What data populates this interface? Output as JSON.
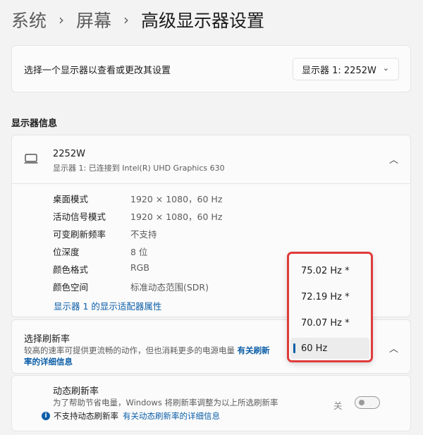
{
  "breadcrumb": [
    "系统",
    "屏幕",
    "高级显示器设置"
  ],
  "breadcrumb_sep": "›",
  "monitor_select": {
    "prompt": "选择一个显示器以查看或更改其设置",
    "value": "显示器 1: 2252W"
  },
  "display_info": {
    "section_title": "显示器信息",
    "device_name": "2252W",
    "device_sub": "显示器 1: 已连接到 Intel(R) UHD Graphics 630",
    "rows": [
      {
        "k": "桌面模式",
        "v": "1920 × 1080，60 Hz"
      },
      {
        "k": "活动信号模式",
        "v": "1920 × 1080，60 Hz"
      },
      {
        "k": "可变刷新频率",
        "v": "不支持"
      },
      {
        "k": "位深度",
        "v": "8 位"
      },
      {
        "k": "颜色格式",
        "v": "RGB"
      },
      {
        "k": "颜色空间",
        "v": "标准动态范围(SDR)"
      }
    ],
    "adapter_link": "显示器 1 的显示适配器属性"
  },
  "refresh_rate": {
    "title": "选择刷新率",
    "desc": "较高的速率可提供更流畅的动作，但也消耗更多的电源电量",
    "link": "有关刷新率的详细信息",
    "options": [
      "75.02 Hz *",
      "72.19 Hz *",
      "70.07 Hz *",
      "60 Hz"
    ],
    "selected": "60 Hz"
  },
  "dynamic_refresh": {
    "title": "动态刷新率",
    "desc": "为了帮助节省电量，Windows 将刷新率调整为以上所选刷新率",
    "note": "不支持动态刷新率",
    "link": "有关动态刷新率的详细信息",
    "toggle_label": "关",
    "toggle_on": false
  },
  "colors": {
    "accent": "#0d5fa8",
    "highlight_frame": "#e03b3b",
    "background": "#f3f3f3"
  }
}
